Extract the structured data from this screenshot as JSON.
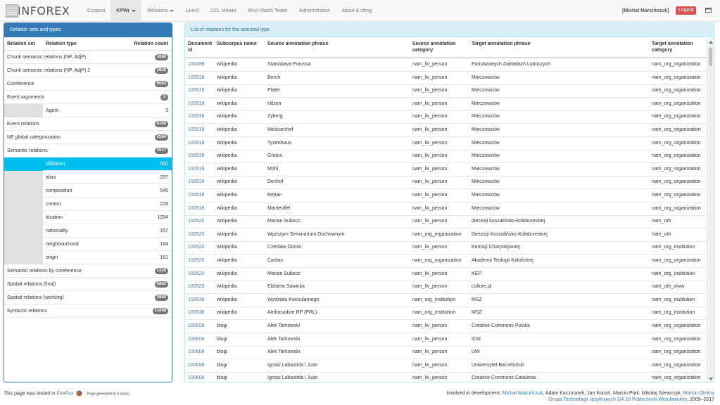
{
  "brand": {
    "name": "INFOREX"
  },
  "nav": [
    {
      "label": "Corpora",
      "active": false,
      "dropdown": false
    },
    {
      "label": "KPWr",
      "active": true,
      "dropdown": true
    },
    {
      "label": "Relations",
      "active": false,
      "dropdown": true
    },
    {
      "label": "Liner2",
      "active": false,
      "dropdown": false
    },
    {
      "label": "CCL Viewer",
      "active": false,
      "dropdown": false
    },
    {
      "label": "Wccl Match Tester",
      "active": false,
      "dropdown": false
    },
    {
      "label": "Administration",
      "active": false,
      "dropdown": false
    },
    {
      "label": "About & citing",
      "active": false,
      "dropdown": false
    }
  ],
  "user": {
    "name": "[Michał Marcińczuk]",
    "logout_label": "Logout"
  },
  "left_panel": {
    "title": "Relation sets and types",
    "headers": {
      "set": "Relation set",
      "type": "Relation type",
      "count": "Relation count"
    },
    "rows": [
      {
        "kind": "set",
        "label": "Chunk semantic relations (NP, AdjP)",
        "count": "1686"
      },
      {
        "kind": "set",
        "label": "Chunk semantic relations (NP, AdjP) 2",
        "count": "2920"
      },
      {
        "kind": "set",
        "label": "Coreference",
        "count": "9063"
      },
      {
        "kind": "set",
        "label": "Event arguments",
        "count": "3"
      },
      {
        "kind": "type",
        "label": "Agent",
        "count": "3",
        "selected": false
      },
      {
        "kind": "set",
        "label": "Event relations",
        "count": "9199"
      },
      {
        "kind": "set",
        "label": "NE global categorization",
        "count": "2584"
      },
      {
        "kind": "set",
        "label": "Semantic relations",
        "count": "3517"
      },
      {
        "kind": "type",
        "label": "affiliation",
        "count": "650",
        "selected": true
      },
      {
        "kind": "type",
        "label": "alias",
        "count": "297",
        "selected": false
      },
      {
        "kind": "type",
        "label": "composition",
        "count": "545",
        "selected": false
      },
      {
        "kind": "type",
        "label": "creator",
        "count": "229",
        "selected": false
      },
      {
        "kind": "type",
        "label": "location",
        "count": "1294",
        "selected": false
      },
      {
        "kind": "type",
        "label": "nationality",
        "count": "157",
        "selected": false
      },
      {
        "kind": "type",
        "label": "neighbourhood",
        "count": "184",
        "selected": false
      },
      {
        "kind": "type",
        "label": "origin",
        "count": "161",
        "selected": false
      },
      {
        "kind": "set",
        "label": "Semantic relations by coreference",
        "count": "1328"
      },
      {
        "kind": "set",
        "label": "Spatial relations (final)",
        "count": "5802"
      },
      {
        "kind": "set",
        "label": "Spatial relations (working)",
        "count": "3960"
      },
      {
        "kind": "set",
        "label": "Syntactic relations",
        "count": "11098"
      }
    ]
  },
  "right_panel": {
    "title": "List of relations for the selected type",
    "columns": {
      "doc": "Document id",
      "subcorpus": "Subcorpus name",
      "source_phrase": "Source annotation phrase",
      "source_category": "Source annotation category",
      "target_phrase": "Target annotation phrase",
      "target_category": "Target annotation category"
    },
    "rows": [
      {
        "doc": "100499",
        "subcorpus": "wikipedia",
        "source_phrase": "Stanisława Praussa",
        "source_category": "nam_liv_person",
        "target_phrase": "Państwowych Zakładach Lotniczych",
        "target_category": "nam_org_organization"
      },
      {
        "doc": "100518",
        "subcorpus": "wikipedia",
        "source_phrase": "Borch",
        "source_category": "nam_liv_person",
        "target_phrase": "Mieczowców",
        "target_category": "nam_org_organization"
      },
      {
        "doc": "100518",
        "subcorpus": "wikipedia",
        "source_phrase": "Plater",
        "source_category": "nam_liv_person",
        "target_phrase": "Mieczowców",
        "target_category": "nam_org_organization"
      },
      {
        "doc": "100518",
        "subcorpus": "wikipedia",
        "source_phrase": "Hilzen",
        "source_category": "nam_liv_person",
        "target_phrase": "Mieczowców",
        "target_category": "nam_org_organization"
      },
      {
        "doc": "100518",
        "subcorpus": "wikipedia",
        "source_phrase": "Zyberg",
        "source_category": "nam_liv_person",
        "target_phrase": "Mieczowców",
        "target_category": "nam_org_organization"
      },
      {
        "doc": "100518",
        "subcorpus": "wikipedia",
        "source_phrase": "Weissenhof",
        "source_category": "nam_liv_person",
        "target_phrase": "Mieczowców",
        "target_category": "nam_org_organization"
      },
      {
        "doc": "100518",
        "subcorpus": "wikipedia",
        "source_phrase": "Tyzenhaus",
        "source_category": "nam_liv_person",
        "target_phrase": "Mieczowców",
        "target_category": "nam_org_organization"
      },
      {
        "doc": "100518",
        "subcorpus": "wikipedia",
        "source_phrase": "Grotus",
        "source_category": "nam_liv_person",
        "target_phrase": "Mieczowców",
        "target_category": "nam_org_organization"
      },
      {
        "doc": "100518",
        "subcorpus": "wikipedia",
        "source_phrase": "Mohl",
        "source_category": "nam_liv_person",
        "target_phrase": "Mieczowców",
        "target_category": "nam_org_organization"
      },
      {
        "doc": "100518",
        "subcorpus": "wikipedia",
        "source_phrase": "Denhof",
        "source_category": "nam_liv_person",
        "target_phrase": "Mieczowców",
        "target_category": "nam_org_organization"
      },
      {
        "doc": "100518",
        "subcorpus": "wikipedia",
        "source_phrase": "Rejtan",
        "source_category": "nam_liv_person",
        "target_phrase": "Mieczowców",
        "target_category": "nam_org_organization"
      },
      {
        "doc": "100518",
        "subcorpus": "wikipedia",
        "source_phrase": "Manteuffel",
        "source_category": "nam_liv_person",
        "target_phrase": "Mieczowców",
        "target_category": "nam_org_organization"
      },
      {
        "doc": "100520",
        "subcorpus": "wikipedia",
        "source_phrase": "Marian Subocz",
        "source_category": "nam_liv_person",
        "target_phrase": "diecezji koszalińsko-kołobrzeskiej",
        "target_category": "nam_oth"
      },
      {
        "doc": "100520",
        "subcorpus": "wikipedia",
        "source_phrase": "Wyższym Seminarium Duchownym",
        "source_category": "nam_org_organization",
        "target_phrase": "Diecezji Koszalińsko-Kołobrzeskiej",
        "target_category": "nam_oth"
      },
      {
        "doc": "100520",
        "subcorpus": "wikipedia",
        "source_phrase": "Czesław Domin",
        "source_category": "nam_liv_person",
        "target_phrase": "Komisji Charytatywnej",
        "target_category": "nam_org_institution"
      },
      {
        "doc": "100520",
        "subcorpus": "wikipedia",
        "source_phrase": "Caritas",
        "source_category": "nam_org_organization",
        "target_phrase": "Akademii Teologii Katolickiej",
        "target_category": "nam_org_organization"
      },
      {
        "doc": "100520",
        "subcorpus": "wikipedia",
        "source_phrase": "Marian Subocz",
        "source_category": "nam_liv_person",
        "target_phrase": "KEP",
        "target_category": "nam_org_institution"
      },
      {
        "doc": "100529",
        "subcorpus": "wikipedia",
        "source_phrase": "Elżbieta Sawicka",
        "source_category": "nam_liv_person",
        "target_phrase": "culture.pl",
        "target_category": "nam_oth_www"
      },
      {
        "doc": "100538",
        "subcorpus": "wikipedia",
        "source_phrase": "Wydziału Konsularnego",
        "source_category": "nam_org_institution",
        "target_phrase": "MSZ",
        "target_category": "nam_org_institution"
      },
      {
        "doc": "100538",
        "subcorpus": "wikipedia",
        "source_phrase": "Ambasadzie RP (PRL)",
        "source_category": "nam_org_institution",
        "target_phrase": "MSZ",
        "target_category": "nam_org_institution"
      },
      {
        "doc": "100608",
        "subcorpus": "blogi",
        "source_phrase": "Alek Tarkowski",
        "source_category": "nam_liv_person",
        "target_phrase": "Creative Commons Polska",
        "target_category": "nam_org_organization"
      },
      {
        "doc": "100608",
        "subcorpus": "blogi",
        "source_phrase": "Alek Tarkowski",
        "source_category": "nam_liv_person",
        "target_phrase": "ICM",
        "target_category": "nam_org_organization"
      },
      {
        "doc": "100608",
        "subcorpus": "blogi",
        "source_phrase": "Alek Tarkowski",
        "source_category": "nam_liv_person",
        "target_phrase": "UW",
        "target_category": "nam_org_organization"
      },
      {
        "doc": "100608",
        "subcorpus": "blogi",
        "source_phrase": "Ignasi Labastida i Juan",
        "source_category": "nam_liv_person",
        "target_phrase": "Uniwersytet Barceloński",
        "target_category": "nam_org_organization"
      },
      {
        "doc": "100608",
        "subcorpus": "blogi",
        "source_phrase": "Ignasi Labastida i Juan",
        "source_category": "nam_liv_person",
        "target_phrase": "Creative Commons Catalonia",
        "target_category": "nam_org_organization"
      }
    ]
  },
  "footer": {
    "tested_prefix": "This page was tested in",
    "firefox": "FireFox",
    "generated": ". Page generated in 0 sec(s).",
    "involved_prefix": "Involved in development:",
    "dev_link_1": "Michał Marcińczuk",
    "dev_others": ", Adam Kaczmarek, Jan Kocoń, Marcin Ptak, Mikołaj Szewczyk,",
    "dev_link_2": "Marcin Oleksy",
    "group_link": "Grupa Technologii Językowych G4.19 Politechniki Wrocławskiej",
    "years": ", 2009–2017"
  },
  "colors": {
    "primary": "#337ab7",
    "selected": "#00bfef",
    "danger": "#d9534f",
    "info_bg": "#d9edf7",
    "badge": "#777777"
  },
  "icons": {
    "logo": "inforex-logo-icon",
    "window": "window-icon",
    "firefox": "firefox-icon"
  }
}
